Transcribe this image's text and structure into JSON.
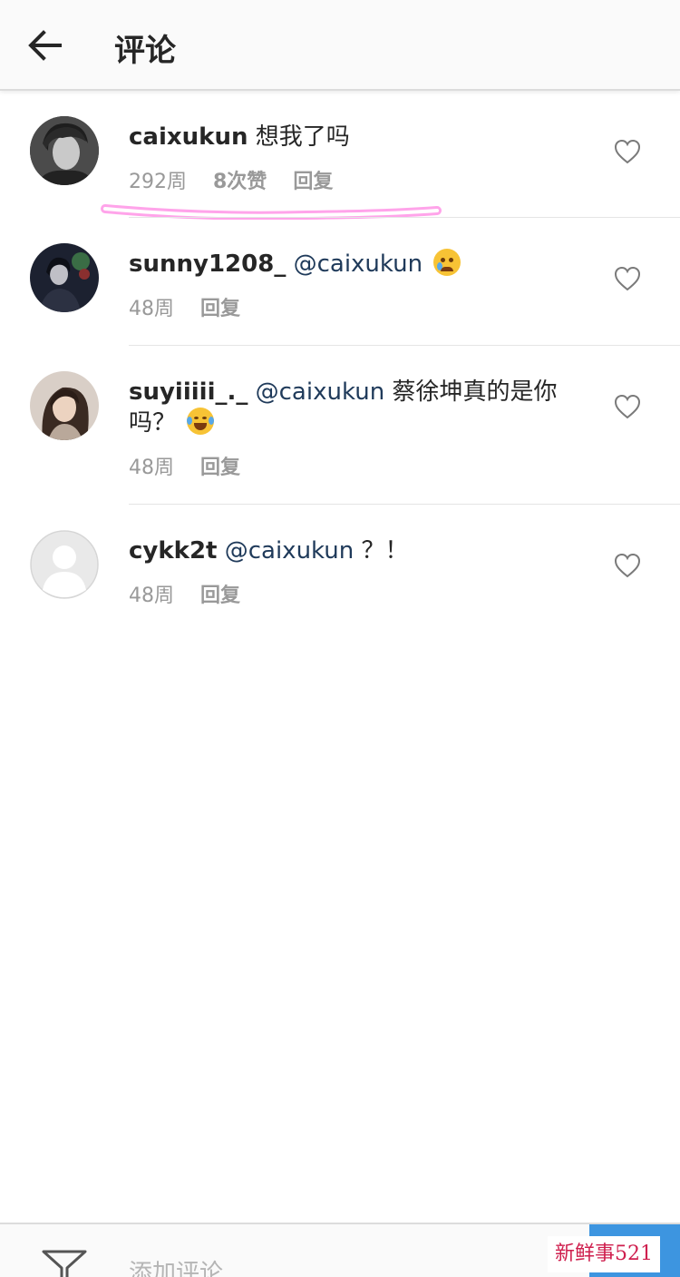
{
  "header": {
    "title": "评论",
    "back_icon": "arrow-left-icon"
  },
  "comments": [
    {
      "username": "caixukun",
      "mention": "",
      "text": "想我了吗",
      "emoji": "",
      "time": "292周",
      "likes": "8次赞",
      "reply": "回复",
      "avatar": "user-photo"
    },
    {
      "username": "sunny1208_",
      "mention": "@caixukun",
      "text": "",
      "emoji": "crying-face",
      "time": "48周",
      "likes": "",
      "reply": "回复",
      "avatar": "user-photo"
    },
    {
      "username": "suyiiiii_._",
      "mention": "@caixukun",
      "text": "蔡徐坤真的是你吗？",
      "emoji": "tears-of-joy",
      "time": "48周",
      "likes": "",
      "reply": "回复",
      "avatar": "user-photo"
    },
    {
      "username": "cykk2t",
      "mention": "@caixukun",
      "text": "？！",
      "emoji": "",
      "time": "48周",
      "likes": "",
      "reply": "回复",
      "avatar": "default-avatar"
    }
  ],
  "composer": {
    "placeholder": "添加评论...",
    "send_icon": "send-icon"
  },
  "watermark": "新鲜事521",
  "colors": {
    "highlight": "#ff5ad9",
    "accent_blue": "#3d95e0",
    "mention": "#1f3a5a",
    "meta": "#999999"
  }
}
